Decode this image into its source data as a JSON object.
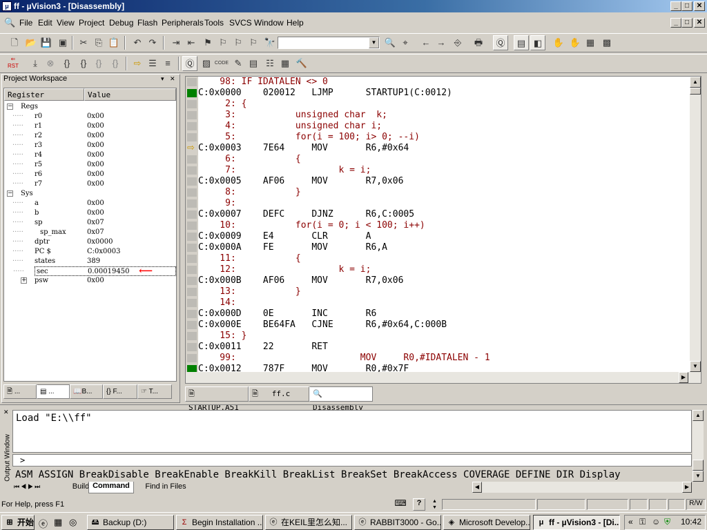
{
  "window": {
    "title": "ff - µVision3 - [Disassembly]",
    "min": "_",
    "max": "□",
    "close": "✕"
  },
  "menu": [
    "File",
    "Edit",
    "View",
    "Project",
    "Debug",
    "Flash",
    "Peripherals",
    "Tools",
    "SVCS",
    "Window",
    "Help"
  ],
  "workspace": {
    "title": "Project Workspace",
    "pin": "▾",
    "close": "✕",
    "col_register": "Register",
    "col_value": "Value",
    "groups": [
      {
        "name": "Regs",
        "expander": "−"
      },
      {
        "name": "Sys",
        "expander": "−"
      }
    ],
    "regs": [
      {
        "name": "r0",
        "value": "0x00"
      },
      {
        "name": "r1",
        "value": "0x00"
      },
      {
        "name": "r2",
        "value": "0x00"
      },
      {
        "name": "r3",
        "value": "0x00"
      },
      {
        "name": "r4",
        "value": "0x00"
      },
      {
        "name": "r5",
        "value": "0x00"
      },
      {
        "name": "r6",
        "value": "0x00"
      },
      {
        "name": "r7",
        "value": "0x00"
      }
    ],
    "sys": [
      {
        "name": "a",
        "value": "0x00"
      },
      {
        "name": "b",
        "value": "0x00"
      },
      {
        "name": "sp",
        "value": "0x07"
      },
      {
        "name": "sp_max",
        "value": "0x07"
      },
      {
        "name": "dptr",
        "value": "0x0000"
      },
      {
        "name": "PC  $",
        "value": "C:0x0003"
      },
      {
        "name": "states",
        "value": "389"
      },
      {
        "name": "sec",
        "value": "0.00019450"
      },
      {
        "name": "psw",
        "value": "0x00",
        "expander": "+"
      }
    ],
    "tabs": [
      "...",
      "...",
      "B...",
      "F...",
      "T..."
    ]
  },
  "editor": {
    "lines": [
      {
        "text": "    98: IF IDATALEN <> 0",
        "src": true
      },
      {
        "text": "C:0x0000    020012   LJMP      STARTUP1(C:0012)",
        "src": false,
        "mark": "green"
      },
      {
        "text": "     2: {",
        "src": true
      },
      {
        "text": "     3:           unsigned char  k;",
        "src": true
      },
      {
        "text": "     4:           unsigned char i;",
        "src": true
      },
      {
        "text": "     5:           for(i = 100; i> 0; --i)",
        "src": true
      },
      {
        "text": "C:0x0003    7E64     MOV       R6,#0x64",
        "src": false,
        "mark": "arrow"
      },
      {
        "text": "     6:           {",
        "src": true
      },
      {
        "text": "     7:                   k = i;",
        "src": true
      },
      {
        "text": "C:0x0005    AF06     MOV       R7,0x06",
        "src": false
      },
      {
        "text": "     8:           }",
        "src": true
      },
      {
        "text": "     9:",
        "src": true
      },
      {
        "text": "C:0x0007    DEFC     DJNZ      R6,C:0005",
        "src": false
      },
      {
        "text": "    10:           for(i = 0; i < 100; i++)",
        "src": true
      },
      {
        "text": "C:0x0009    E4       CLR       A",
        "src": false
      },
      {
        "text": "C:0x000A    FE       MOV       R6,A",
        "src": false
      },
      {
        "text": "    11:           {",
        "src": true
      },
      {
        "text": "    12:                   k = i;",
        "src": true
      },
      {
        "text": "C:0x000B    AF06     MOV       R7,0x06",
        "src": false
      },
      {
        "text": "    13:           }",
        "src": true
      },
      {
        "text": "    14:",
        "src": true
      },
      {
        "text": "C:0x000D    0E       INC       R6",
        "src": false
      },
      {
        "text": "C:0x000E    BE64FA   CJNE      R6,#0x64,C:000B",
        "src": false
      },
      {
        "text": "    15: }",
        "src": true
      },
      {
        "text": "C:0x0011    22       RET",
        "src": false
      },
      {
        "text": "    99:                       MOV     R0,#IDATALEN - 1",
        "src": true
      },
      {
        "text": "C:0x0012    787F     MOV       R0,#0x7F",
        "src": false,
        "mark": "green"
      }
    ],
    "tabs": [
      "STARTUP.A51",
      "ff.c",
      "Disassembly"
    ]
  },
  "output": {
    "side_label": "Output Window",
    "text": "Load \"E:\\\\ff\"",
    "prompt": ">",
    "commands": "ASM ASSIGN BreakDisable BreakEnable BreakKill BreakList BreakSet BreakAccess COVERAGE DEFINE DIR Display",
    "tabs": [
      "Build",
      "Command",
      "Find in Files"
    ]
  },
  "status": {
    "help": "For Help, press F1",
    "mode": "R/W"
  },
  "taskbar": {
    "start": "开始",
    "tasks": [
      "Backup (D:)",
      "Begin Installation ...",
      "在KEIL里怎么知...",
      "RABBIT3000 - Go...",
      "Microsoft Develop...",
      "ff - µVision3 - [Di..."
    ],
    "tray_chevron": "«",
    "clock": "10:42"
  },
  "colors": {
    "accent": "#0a246a",
    "source": "#8b0000",
    "marker_green": "#008000",
    "arrow": "#ff0000"
  }
}
